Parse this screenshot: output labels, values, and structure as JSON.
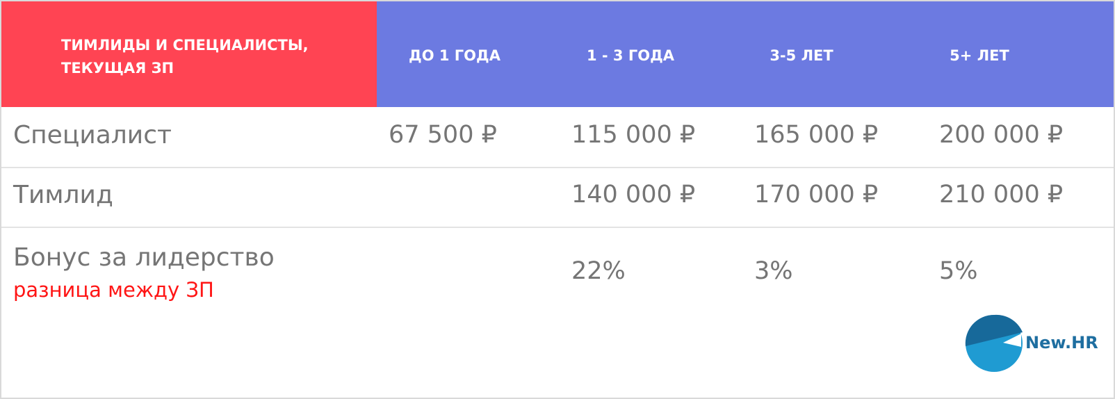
{
  "header": {
    "title_line1": "ТИМЛИДЫ И СПЕЦИАЛИСТЫ,",
    "title_line2": "ТЕКУЩАЯ ЗП",
    "columns": [
      "ДО 1 ГОДА",
      "1 - 3 ГОДА",
      "3-5 ЛЕТ",
      "5+ ЛЕТ"
    ]
  },
  "rows": [
    {
      "label": "Специалист",
      "values": [
        "67 500 ₽",
        "115 000 ₽",
        "165 000 ₽",
        "200 000 ₽"
      ]
    },
    {
      "label": "Тимлид",
      "values": [
        "",
        "140 000 ₽",
        "170 000 ₽",
        "210 000 ₽"
      ]
    },
    {
      "label": "Бонус за лидерство",
      "sublabel": "разница между ЗП",
      "values": [
        "",
        "22%",
        "3%",
        "5%"
      ]
    }
  ],
  "logo": {
    "text": "New.HR"
  },
  "colors": {
    "header_red": "#ff4453",
    "header_blue": "#6c7ae1",
    "text_gray": "#757575",
    "accent_red": "#ff1515",
    "logo_blue": "#1e6ea0"
  }
}
